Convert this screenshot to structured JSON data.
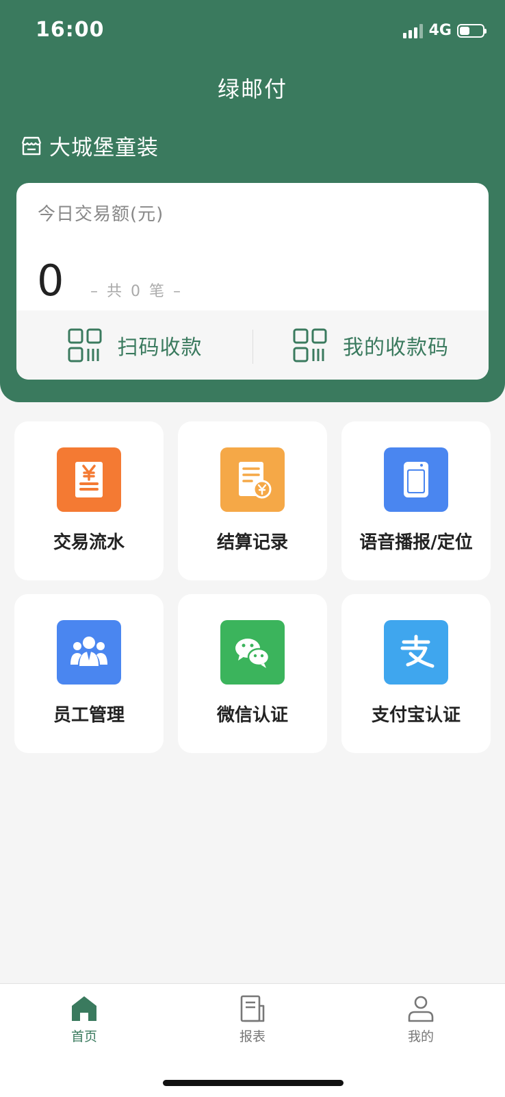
{
  "status_bar": {
    "time": "16:00",
    "network": "4G"
  },
  "header": {
    "title": "绿邮付",
    "store_name": "大城堡童装"
  },
  "summary": {
    "label": "今日交易额(元)",
    "amount": "0",
    "count_text": "– 共 0 笔 –"
  },
  "actions": [
    {
      "label": "扫码收款",
      "icon": "qr-scan-icon"
    },
    {
      "label": "我的收款码",
      "icon": "qr-code-icon"
    }
  ],
  "tiles": [
    {
      "label": "交易流水",
      "icon": "receipt-yen-icon",
      "color": "#f47a33"
    },
    {
      "label": "结算记录",
      "icon": "settlement-doc-icon",
      "color": "#f5a847"
    },
    {
      "label": "语音播报/定位",
      "icon": "speaker-device-icon",
      "color": "#4a86f0"
    },
    {
      "label": "员工管理",
      "icon": "staff-group-icon",
      "color": "#4a86f0"
    },
    {
      "label": "微信认证",
      "icon": "wechat-icon",
      "color": "#3bb45c"
    },
    {
      "label": "支付宝认证",
      "icon": "alipay-icon",
      "color": "#3fa6ee"
    }
  ],
  "tabbar": {
    "items": [
      {
        "label": "首页",
        "icon": "home-icon",
        "active": true
      },
      {
        "label": "报表",
        "icon": "report-icon",
        "active": false
      },
      {
        "label": "我的",
        "icon": "profile-icon",
        "active": false
      }
    ],
    "active_color": "#3a7a5e",
    "inactive_color": "#777777"
  },
  "colors": {
    "brand": "#3a7a5e",
    "background": "#f5f5f5"
  }
}
